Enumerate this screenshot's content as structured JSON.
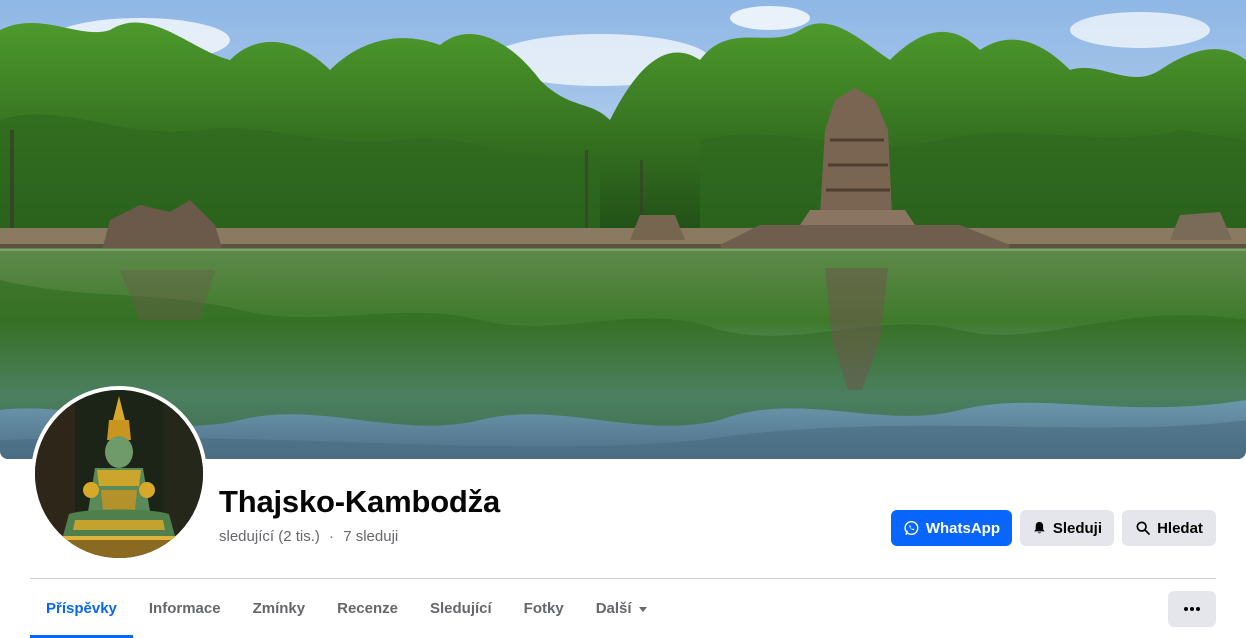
{
  "page": {
    "name": "Thajsko-Kambodža",
    "followers": "sledující (2 tis.)",
    "separator": "·",
    "following": "7 sleduji"
  },
  "actions": {
    "whatsapp_label": "WhatsApp",
    "follow_label": "Sleduji",
    "search_label": "Hledat"
  },
  "tabs": [
    {
      "label": "Příspěvky",
      "active": true
    },
    {
      "label": "Informace"
    },
    {
      "label": "Zmínky"
    },
    {
      "label": "Recenze"
    },
    {
      "label": "Sledující"
    },
    {
      "label": "Fotky"
    },
    {
      "label": "Další",
      "has_dropdown": true
    }
  ],
  "icons": {
    "whatsapp": "whatsapp-icon",
    "follow": "bell-icon",
    "search": "search-icon",
    "more": "more-dots-icon",
    "dropdown": "caret-down-icon"
  },
  "colors": {
    "accent": "#0866ff",
    "secondary_button": "#e4e6eb",
    "muted_text": "#65676b",
    "title_text": "#050505"
  }
}
